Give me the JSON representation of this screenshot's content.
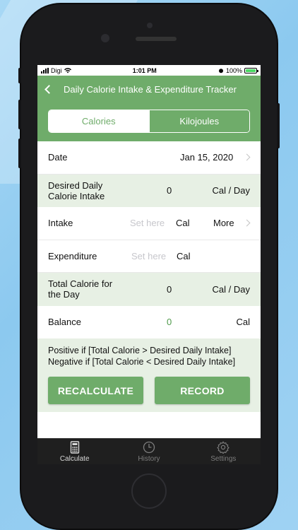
{
  "status": {
    "carrier": "Digi",
    "time": "1:01 PM",
    "battery": "100%"
  },
  "nav": {
    "title": "Daily Calorie Intake & Expenditure Tracker"
  },
  "segments": {
    "calories": "Calories",
    "kilojoules": "Kilojoules",
    "selected": "Calories"
  },
  "rows": {
    "date": {
      "label": "Date",
      "value": "Jan 15, 2020"
    },
    "desired": {
      "label": "Desired Daily Calorie Intake",
      "value": "0",
      "unit": "Cal / Day"
    },
    "intake": {
      "label": "Intake",
      "placeholder": "Set here",
      "unit": "Cal",
      "more": "More"
    },
    "expenditure": {
      "label": "Expenditure",
      "placeholder": "Set here",
      "unit": "Cal"
    },
    "total": {
      "label": "Total Calorie for the Day",
      "value": "0",
      "unit": "Cal / Day"
    },
    "balance": {
      "label": "Balance",
      "value": "0",
      "unit": "Cal"
    }
  },
  "note": {
    "line1": "Positive if [Total Calorie > Desired Daily Intake]",
    "line2": "Negative if [Total Calorie < Desired Daily Intake]"
  },
  "buttons": {
    "recalculate": "RECALCULATE",
    "record": "RECORD"
  },
  "tabs": {
    "calculate": "Calculate",
    "history": "History",
    "settings": "Settings"
  },
  "colors": {
    "accent": "#6fac6a",
    "row_alt": "#e7f0e4",
    "balance_value": "#4f9a4b"
  }
}
